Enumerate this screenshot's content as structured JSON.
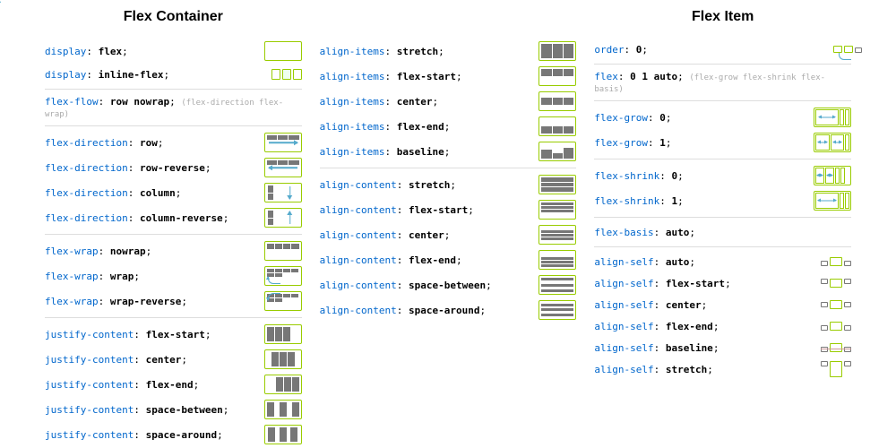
{
  "headings": {
    "container": "Flex Container",
    "item": "Flex Item"
  },
  "c1": [
    {
      "p": "display",
      "v": "flex",
      "ico": "empty"
    },
    {
      "p": "display",
      "v": "inline-flex",
      "ico": "three"
    },
    {
      "sep": true
    },
    {
      "p": "flex-flow",
      "v": "row nowrap",
      "note": "(flex-direction flex-wrap)"
    },
    {
      "sep": true
    },
    {
      "p": "flex-direction",
      "v": "row",
      "ico": "arr-r"
    },
    {
      "p": "flex-direction",
      "v": "row-reverse",
      "ico": "arr-l"
    },
    {
      "p": "flex-direction",
      "v": "column",
      "ico": "arr-d"
    },
    {
      "p": "flex-direction",
      "v": "column-reverse",
      "ico": "arr-u"
    },
    {
      "sep": true
    },
    {
      "p": "flex-wrap",
      "v": "nowrap",
      "ico": "nowrap"
    },
    {
      "p": "flex-wrap",
      "v": "wrap",
      "ico": "wrap"
    },
    {
      "p": "flex-wrap",
      "v": "wrap-reverse",
      "ico": "wraprev"
    },
    {
      "sep": true
    },
    {
      "p": "justify-content",
      "v": "flex-start",
      "ico": "jstart"
    },
    {
      "p": "justify-content",
      "v": "center",
      "ico": "jcenter"
    },
    {
      "p": "justify-content",
      "v": "flex-end",
      "ico": "jend"
    },
    {
      "p": "justify-content",
      "v": "space-between",
      "ico": "jbetween"
    },
    {
      "p": "justify-content",
      "v": "space-around",
      "ico": "jaround"
    }
  ],
  "c2": [
    {
      "p": "align-items",
      "v": "stretch",
      "ico": "aistr"
    },
    {
      "p": "align-items",
      "v": "flex-start",
      "ico": "aistart"
    },
    {
      "p": "align-items",
      "v": "center",
      "ico": "aictr"
    },
    {
      "p": "align-items",
      "v": "flex-end",
      "ico": "aiend"
    },
    {
      "p": "align-items",
      "v": "baseline",
      "ico": "aibase"
    },
    {
      "sep": true
    },
    {
      "p": "align-content",
      "v": "stretch",
      "ico": "acstr"
    },
    {
      "p": "align-content",
      "v": "flex-start",
      "ico": "acstart"
    },
    {
      "p": "align-content",
      "v": "center",
      "ico": "acctr"
    },
    {
      "p": "align-content",
      "v": "flex-end",
      "ico": "acend"
    },
    {
      "p": "align-content",
      "v": "space-between",
      "ico": "acbet"
    },
    {
      "p": "align-content",
      "v": "space-around",
      "ico": "acaro"
    }
  ],
  "c3": [
    {
      "p": "order",
      "v": "0",
      "ico": "order"
    },
    {
      "sep": true
    },
    {
      "p": "flex",
      "v": "0 1 auto",
      "note": "(flex-grow flex-shrink flex-basis)"
    },
    {
      "sep": true
    },
    {
      "p": "flex-grow",
      "v": "0",
      "ico": "grow0"
    },
    {
      "p": "flex-grow",
      "v": "1",
      "ico": "grow1"
    },
    {
      "sep": true
    },
    {
      "p": "flex-shrink",
      "v": "0",
      "ico": "shrink0"
    },
    {
      "p": "flex-shrink",
      "v": "1",
      "ico": "shrink1"
    },
    {
      "sep": true
    },
    {
      "p": "flex-basis",
      "v": "auto"
    },
    {
      "sep": true
    },
    {
      "p": "align-self",
      "v": "auto",
      "ico": "asauto"
    },
    {
      "p": "align-self",
      "v": "flex-start",
      "ico": "asstart"
    },
    {
      "p": "align-self",
      "v": "center",
      "ico": "asctr"
    },
    {
      "p": "align-self",
      "v": "flex-end",
      "ico": "asend"
    },
    {
      "p": "align-self",
      "v": "baseline",
      "ico": "asbase"
    },
    {
      "p": "align-self",
      "v": "stretch",
      "ico": "asstr"
    }
  ]
}
